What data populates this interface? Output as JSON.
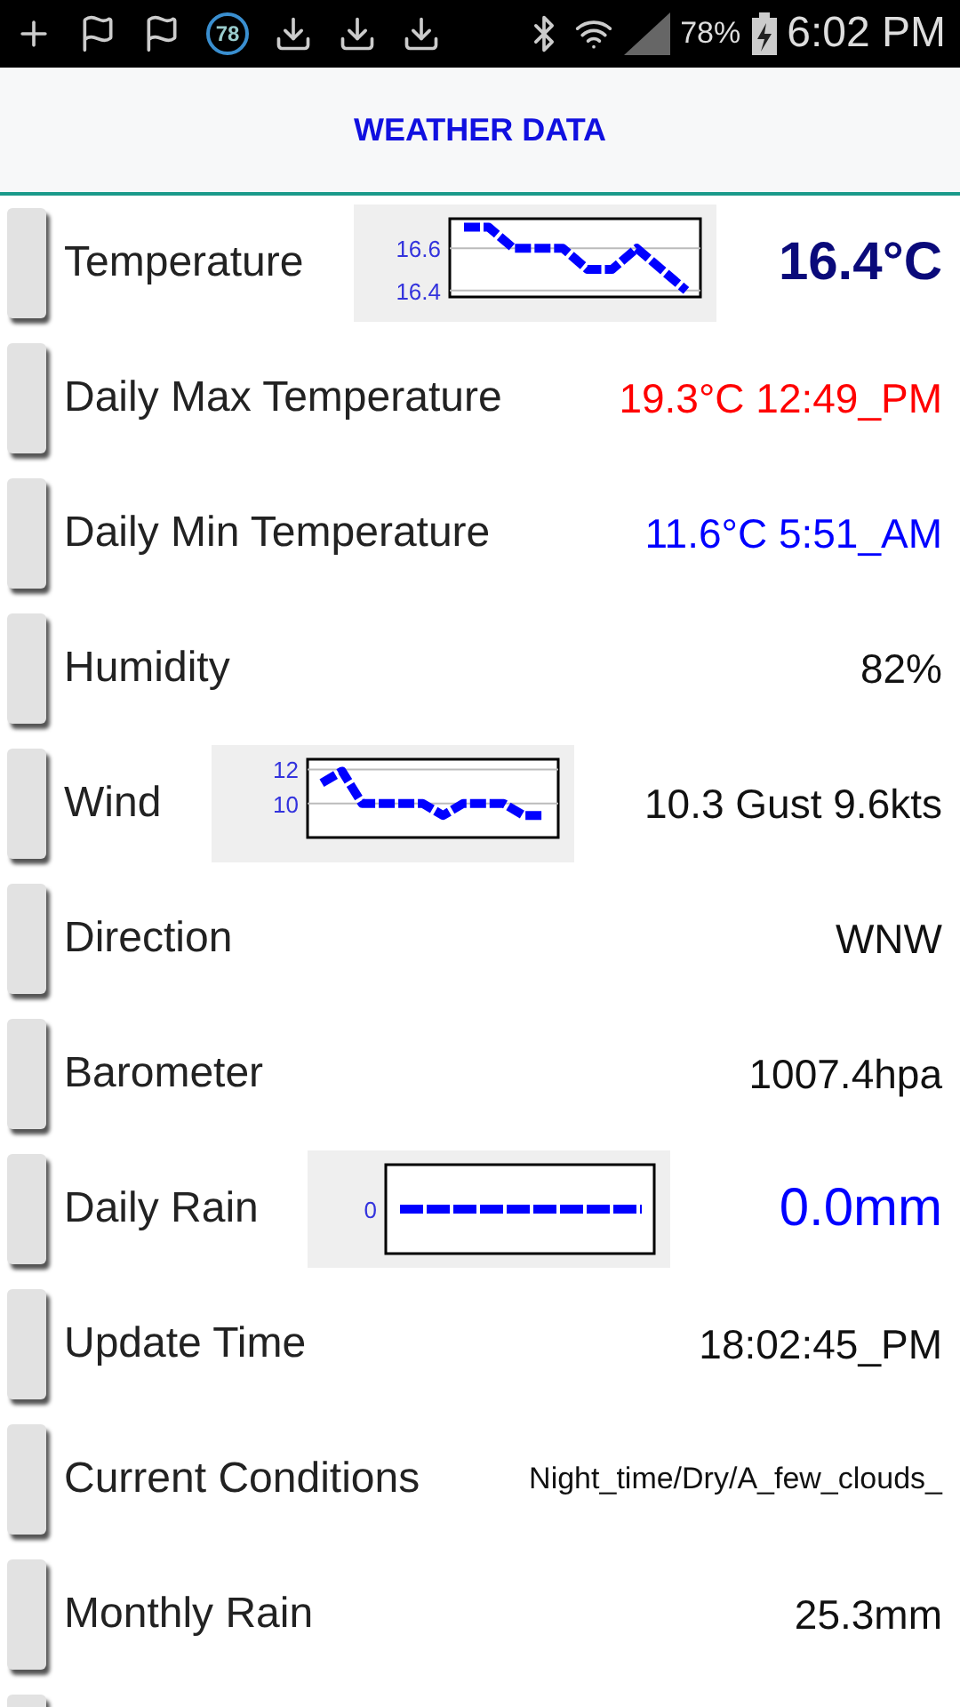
{
  "status_bar": {
    "badge": "78",
    "battery": "78%",
    "time": "6:02 PM"
  },
  "header": {
    "title": "WEATHER DATA"
  },
  "rows": [
    {
      "label": "Temperature",
      "value": "16.4°C",
      "color": "#0a0a7a",
      "kind": "large-bold",
      "chart_data": {
        "type": "line",
        "series": [
          {
            "color": "#0000ff",
            "line_style": "dotted",
            "values": [
              16.7,
              16.7,
              16.6,
              16.6,
              16.6,
              16.5,
              16.5,
              16.6,
              16.5,
              16.4
            ]
          }
        ],
        "ylim": [
          16.37,
          16.74
        ],
        "yticks": [
          16.4,
          16.6
        ]
      }
    },
    {
      "label": "Daily Max Temperature",
      "value": "19.3°C 12:49_PM",
      "color": "#ff0000",
      "kind": "normal"
    },
    {
      "label": "Daily Min Temperature",
      "value": "11.6°C 5:51_AM",
      "color": "#0000ff",
      "kind": "normal"
    },
    {
      "label": "Humidity",
      "value": "82%",
      "color": "#111111",
      "kind": "normal"
    },
    {
      "label": "Wind",
      "value": "10.3 Gust 9.6kts",
      "color": "#111111",
      "kind": "normal",
      "chart_data": {
        "type": "line",
        "series": [
          {
            "color": "#0000ff",
            "line_style": "dotted",
            "values": [
              11.2,
              11.9,
              10,
              10,
              10,
              10,
              9.3,
              10,
              10,
              10,
              9.3,
              9.3
            ]
          }
        ],
        "ylim": [
          8,
          12.6
        ],
        "yticks": [
          10,
          12
        ]
      }
    },
    {
      "label": "Direction",
      "value": "WNW",
      "color": "#111111",
      "kind": "normal"
    },
    {
      "label": "Barometer",
      "value": "1007.4hpa",
      "color": "#111111",
      "kind": "normal"
    },
    {
      "label": "Daily Rain",
      "value": "0.0mm",
      "color": "#0000ff",
      "kind": "large",
      "sparkline": {
        "tick_label": "0"
      }
    },
    {
      "label": "Update Time",
      "value": "18:02:45_PM",
      "color": "#111111",
      "kind": "normal"
    },
    {
      "label": "Current Conditions",
      "value": "Night_time/Dry/A_few_clouds_",
      "color": "#111111",
      "kind": "small"
    },
    {
      "label": "Monthly Rain",
      "value": "25.3mm",
      "color": "#111111",
      "kind": "normal"
    }
  ]
}
